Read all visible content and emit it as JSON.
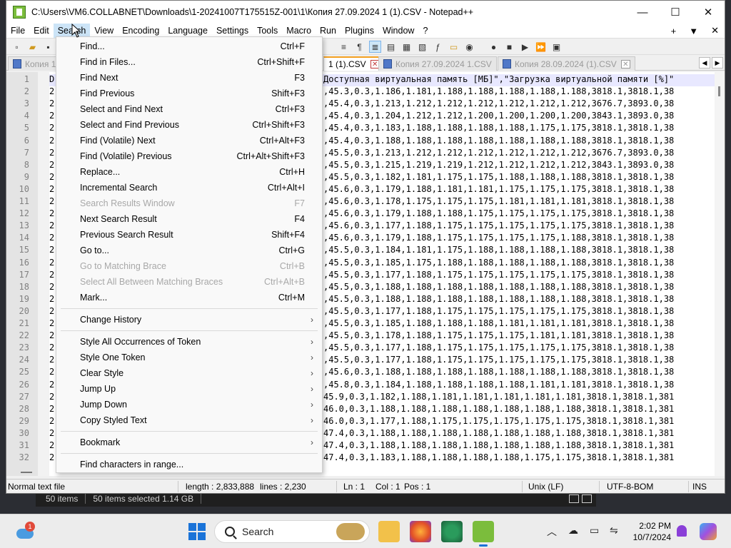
{
  "window": {
    "title": "C:\\Users\\VM6.COLLABNET\\Downloads\\1-20241007T175515Z-001\\1\\Копия 27.09.2024 1 (1).CSV - Notepad++",
    "min": "—",
    "max": "☐",
    "close": "✕"
  },
  "menubar": {
    "items": [
      "File",
      "Edit",
      "Search",
      "View",
      "Encoding",
      "Language",
      "Settings",
      "Tools",
      "Macro",
      "Run",
      "Plugins",
      "Window",
      "?"
    ],
    "right": [
      "+",
      "▼",
      "✕"
    ]
  },
  "tabs": [
    {
      "label": "Копия 1",
      "state": "inactive"
    },
    {
      "label": "1 (1).CSV",
      "state": "active"
    },
    {
      "label": "Копия 27.09.2024 1.CSV",
      "state": "inactive"
    },
    {
      "label": "Копия 28.09.2024 (1).CSV",
      "state": "inactive"
    }
  ],
  "editor": {
    "line_numbers": [
      "1",
      "2",
      "3",
      "4",
      "5",
      "6",
      "7",
      "8",
      "9",
      "10",
      "11",
      "12",
      "13",
      "14",
      "15",
      "16",
      "17",
      "18",
      "19",
      "20",
      "21",
      "22",
      "23",
      "24",
      "25",
      "26",
      "27",
      "28",
      "29",
      "30",
      "31",
      "32"
    ],
    "lead_chars": [
      "D",
      "2",
      "2",
      "2",
      "2",
      "2",
      "2",
      "2",
      "2",
      "2",
      "2",
      "2",
      "2",
      "2",
      "2",
      "2",
      "2",
      "2",
      "2",
      "2",
      "2",
      "2",
      "2",
      "2",
      "2",
      "2",
      "2",
      "2",
      "2",
      "2",
      "2",
      "2"
    ],
    "visible_text": [
      "Доступная виртуальная память [МБ]\",\"Загрузка виртуальной памяти [%]\"",
      ",45.3,0.3,1.186,1.181,1.188,1.188,1.188,1.188,1.188,3818.1,3818.1,38",
      ",45.4,0.3,1.213,1.212,1.212,1.212,1.212,1.212,1.212,3676.7,3893.0,38",
      ",45.4,0.3,1.204,1.212,1.212,1.200,1.200,1.200,1.200,3843.1,3893.0,38",
      ",45.4,0.3,1.183,1.188,1.188,1.188,1.188,1.175,1.175,3818.1,3818.1,38",
      ",45.4,0.3,1.188,1.188,1.188,1.188,1.188,1.188,1.188,3818.1,3818.1,38",
      ",45.5,0.3,1.213,1.212,1.212,1.212,1.212,1.212,1.212,3676.7,3893.0,38",
      ",45.5,0.3,1.215,1.219,1.219,1.212,1.212,1.212,1.212,3843.1,3893.0,38",
      ",45.5,0.3,1.182,1.181,1.175,1.175,1.188,1.188,1.188,3818.1,3818.1,38",
      ",45.6,0.3,1.179,1.188,1.181,1.181,1.175,1.175,1.175,3818.1,3818.1,38",
      ",45.6,0.3,1.178,1.175,1.175,1.175,1.181,1.181,1.181,3818.1,3818.1,38",
      ",45.6,0.3,1.179,1.188,1.188,1.175,1.175,1.175,1.175,3818.1,3818.1,38",
      ",45.6,0.3,1.177,1.188,1.175,1.175,1.175,1.175,1.175,3818.1,3818.1,38",
      ",45.6,0.3,1.179,1.188,1.175,1.175,1.175,1.175,1.188,3818.1,3818.1,38",
      ",45.5,0.3,1.184,1.181,1.175,1.188,1.188,1.188,1.188,3818.1,3818.1,38",
      ",45.5,0.3,1.185,1.175,1.188,1.188,1.188,1.188,1.188,3818.1,3818.1,38",
      ",45.5,0.3,1.177,1.188,1.175,1.175,1.175,1.175,1.175,3818.1,3818.1,38",
      ",45.5,0.3,1.188,1.188,1.188,1.188,1.188,1.188,1.188,3818.1,3818.1,38",
      ",45.5,0.3,1.188,1.188,1.188,1.188,1.188,1.188,1.188,3818.1,3818.1,38",
      ",45.5,0.3,1.177,1.188,1.175,1.175,1.175,1.175,1.175,3818.1,3818.1,38",
      ",45.5,0.3,1.185,1.188,1.188,1.188,1.181,1.181,1.181,3818.1,3818.1,38",
      ",45.5,0.3,1.178,1.188,1.175,1.175,1.175,1.181,1.181,3818.1,3818.1,38",
      ",45.5,0.3,1.177,1.188,1.175,1.175,1.175,1.175,1.175,3818.1,3818.1,38",
      ",45.5,0.3,1.177,1.188,1.175,1.175,1.175,1.175,1.175,3818.1,3818.1,38",
      ",45.6,0.3,1.188,1.188,1.188,1.188,1.188,1.188,1.188,3818.1,3818.1,38",
      ",45.8,0.3,1.184,1.188,1.188,1.188,1.188,1.181,1.181,3818.1,3818.1,38",
      "45.9,0.3,1.182,1.188,1.181,1.181,1.181,1.181,1.181,3818.1,3818.1,381",
      "46.0,0.3,1.188,1.188,1.188,1.188,1.188,1.188,1.188,3818.1,3818.1,381",
      "46.0,0.3,1.177,1.188,1.175,1.175,1.175,1.175,1.175,3818.1,3818.1,381",
      "47.4,0.3,1.188,1.188,1.188,1.188,1.188,1.188,1.188,3818.1,3818.1,381",
      "47.4,0.3,1.188,1.188,1.188,1.188,1.188,1.188,1.188,3818.1,3818.1,381",
      "47.4,0.3,1.183,1.188,1.188,1.188,1.188,1.175,1.175,3818.1,3818.1,381"
    ]
  },
  "search_menu": {
    "items": [
      {
        "label": "Find...",
        "shortcut": "Ctrl+F",
        "enabled": true
      },
      {
        "label": "Find in Files...",
        "shortcut": "Ctrl+Shift+F",
        "enabled": true
      },
      {
        "label": "Find Next",
        "shortcut": "F3",
        "enabled": true
      },
      {
        "label": "Find Previous",
        "shortcut": "Shift+F3",
        "enabled": true
      },
      {
        "label": "Select and Find Next",
        "shortcut": "Ctrl+F3",
        "enabled": true
      },
      {
        "label": "Select and Find Previous",
        "shortcut": "Ctrl+Shift+F3",
        "enabled": true
      },
      {
        "label": "Find (Volatile) Next",
        "shortcut": "Ctrl+Alt+F3",
        "enabled": true
      },
      {
        "label": "Find (Volatile) Previous",
        "shortcut": "Ctrl+Alt+Shift+F3",
        "enabled": true
      },
      {
        "label": "Replace...",
        "shortcut": "Ctrl+H",
        "enabled": true
      },
      {
        "label": "Incremental Search",
        "shortcut": "Ctrl+Alt+I",
        "enabled": true
      },
      {
        "label": "Search Results Window",
        "shortcut": "F7",
        "enabled": false
      },
      {
        "label": "Next Search Result",
        "shortcut": "F4",
        "enabled": true
      },
      {
        "label": "Previous Search Result",
        "shortcut": "Shift+F4",
        "enabled": true
      },
      {
        "label": "Go to...",
        "shortcut": "Ctrl+G",
        "enabled": true
      },
      {
        "label": "Go to Matching Brace",
        "shortcut": "Ctrl+B",
        "enabled": false
      },
      {
        "label": "Select All Between Matching Braces",
        "shortcut": "Ctrl+Alt+B",
        "enabled": false
      },
      {
        "label": "Mark...",
        "shortcut": "Ctrl+M",
        "enabled": true
      },
      {
        "label": "Change History",
        "submenu": true
      },
      {
        "label": "Style All Occurrences of Token",
        "submenu": true
      },
      {
        "label": "Style One Token",
        "submenu": true
      },
      {
        "label": "Clear Style",
        "submenu": true
      },
      {
        "label": "Jump Up",
        "submenu": true
      },
      {
        "label": "Jump Down",
        "submenu": true
      },
      {
        "label": "Copy Styled Text",
        "submenu": true
      },
      {
        "label": "Bookmark",
        "submenu": true
      },
      {
        "label": "Find characters in range..."
      }
    ]
  },
  "statusbar": {
    "file_type": "Normal text file",
    "length": "length : 2,833,888",
    "lines": "lines : 2,230",
    "ln": "Ln : 1",
    "col": "Col : 1",
    "pos": "Pos : 1",
    "eol": "Unix (LF)",
    "encoding": "UTF-8-BOM",
    "mode": "INS"
  },
  "explorer": {
    "items": "50 items",
    "selected": "50 items selected  1.14 GB"
  },
  "taskbar": {
    "search_label": "Search",
    "time": "2:02 PM",
    "date": "10/7/2024",
    "weather_badge": "1"
  },
  "colors": {
    "accent": "#1a73d8",
    "menu_highlight": "#cce4f7",
    "active_tab_marker": "#f4a020"
  }
}
